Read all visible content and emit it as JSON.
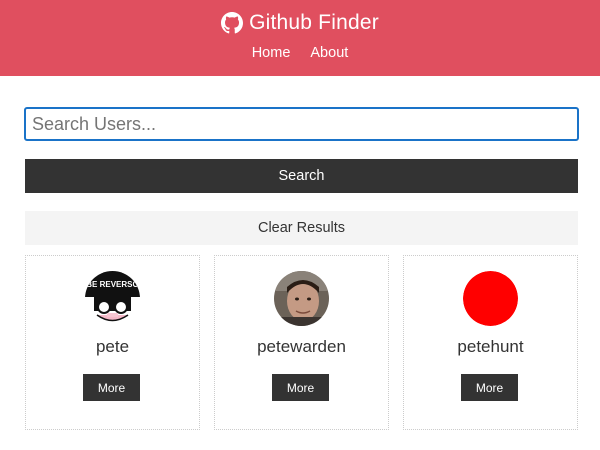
{
  "navbar": {
    "brand_icon": "github-icon",
    "title": "Github Finder",
    "links": [
      {
        "label": "Home"
      },
      {
        "label": "About"
      }
    ],
    "background": "#e04f5f"
  },
  "search": {
    "placeholder": "Search Users...",
    "value": "",
    "button_label": "Search",
    "clear_label": "Clear Results"
  },
  "users": [
    {
      "login": "pete",
      "avatar": "be-reverso-avatar-image",
      "more_label": "More"
    },
    {
      "login": "petewarden",
      "avatar": "portrait-photo-avatar",
      "more_label": "More"
    },
    {
      "login": "petehunt",
      "avatar": "red-circle-avatar",
      "avatar_color": "#ff0000",
      "more_label": "More"
    }
  ],
  "colors": {
    "dark": "#333333",
    "light": "#f4f4f4",
    "focus": "#1a73c8"
  }
}
